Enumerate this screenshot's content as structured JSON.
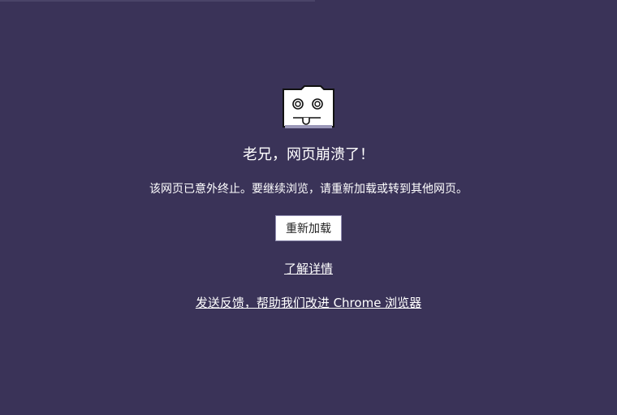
{
  "theme": {
    "background": "#3a3358",
    "text": "#ffffff",
    "button_bg": "#ffffff",
    "button_text": "#222222"
  },
  "error": {
    "icon": "sad-tab-icon",
    "title": "老兄，网页崩溃了！",
    "message": "该网页已意外终止。要继续浏览，请重新加载或转到其他网页。"
  },
  "actions": {
    "reload_label": "重新加载",
    "learn_more_label": "了解详情",
    "feedback_label": "发送反馈，帮助我们改进 Chrome 浏览器"
  }
}
